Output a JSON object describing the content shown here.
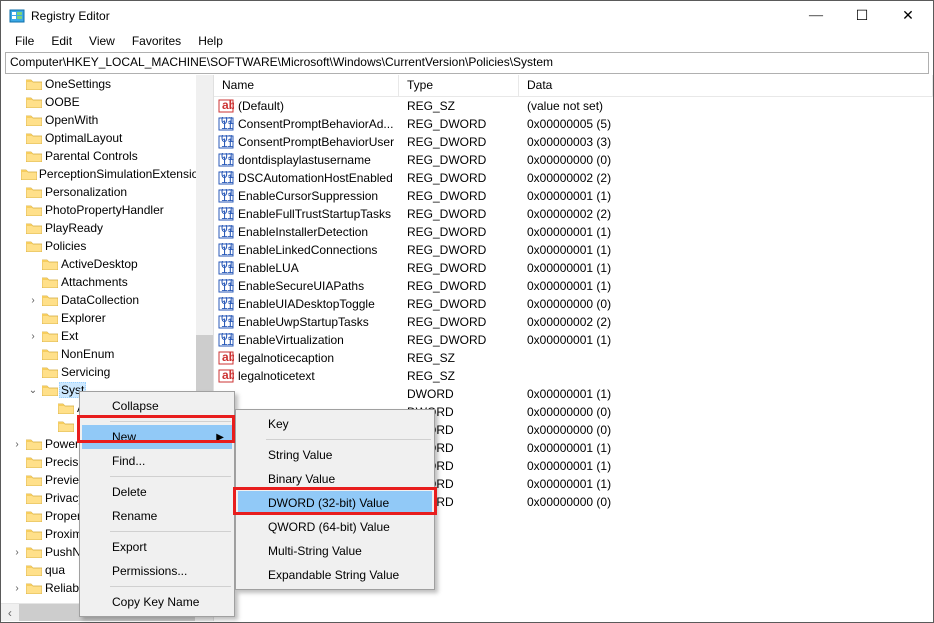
{
  "window": {
    "title": "Registry Editor"
  },
  "menu": {
    "file": "File",
    "edit": "Edit",
    "view": "View",
    "favorites": "Favorites",
    "help": "Help"
  },
  "address": {
    "path": "Computer\\HKEY_LOCAL_MACHINE\\SOFTWARE\\Microsoft\\Windows\\CurrentVersion\\Policies\\System"
  },
  "tree": {
    "items": [
      {
        "label": "OneSettings",
        "indent": 0,
        "expander": ""
      },
      {
        "label": "OOBE",
        "indent": 0,
        "expander": ""
      },
      {
        "label": "OpenWith",
        "indent": 0,
        "expander": ""
      },
      {
        "label": "OptimalLayout",
        "indent": 0,
        "expander": ""
      },
      {
        "label": "Parental Controls",
        "indent": 0,
        "expander": ""
      },
      {
        "label": "PerceptionSimulationExtensions",
        "indent": 0,
        "expander": ""
      },
      {
        "label": "Personalization",
        "indent": 0,
        "expander": ""
      },
      {
        "label": "PhotoPropertyHandler",
        "indent": 0,
        "expander": ""
      },
      {
        "label": "PlayReady",
        "indent": 0,
        "expander": ""
      },
      {
        "label": "Policies",
        "indent": 0,
        "expander": ""
      },
      {
        "label": "ActiveDesktop",
        "indent": 1,
        "expander": ""
      },
      {
        "label": "Attachments",
        "indent": 1,
        "expander": ""
      },
      {
        "label": "DataCollection",
        "indent": 1,
        "expander": ">"
      },
      {
        "label": "Explorer",
        "indent": 1,
        "expander": ""
      },
      {
        "label": "Ext",
        "indent": 1,
        "expander": ">"
      },
      {
        "label": "NonEnum",
        "indent": 1,
        "expander": ""
      },
      {
        "label": "Servicing",
        "indent": 1,
        "expander": ""
      },
      {
        "label": "Syst",
        "indent": 1,
        "expander": "v",
        "selected": true
      },
      {
        "label": "A",
        "indent": 2,
        "expander": ""
      },
      {
        "label": "U",
        "indent": 2,
        "expander": ""
      },
      {
        "label": "PowerE",
        "indent": 0,
        "expander": ">"
      },
      {
        "label": "Precisio",
        "indent": 0,
        "expander": ""
      },
      {
        "label": "Preview",
        "indent": 0,
        "expander": ""
      },
      {
        "label": "Privacy",
        "indent": 0,
        "expander": ""
      },
      {
        "label": "Proper",
        "indent": 0,
        "expander": ""
      },
      {
        "label": "Proxim",
        "indent": 0,
        "expander": ""
      },
      {
        "label": "PushN",
        "indent": 0,
        "expander": ">"
      },
      {
        "label": "qua",
        "indent": 0,
        "expander": ""
      },
      {
        "label": "Reliability",
        "indent": 0,
        "expander": ">"
      }
    ]
  },
  "list": {
    "columns": {
      "name": "Name",
      "type": "Type",
      "data": "Data"
    },
    "rows": [
      {
        "icon": "sz",
        "name": "(Default)",
        "type": "REG_SZ",
        "data": "(value not set)"
      },
      {
        "icon": "dw",
        "name": "ConsentPromptBehaviorAd...",
        "type": "REG_DWORD",
        "data": "0x00000005 (5)"
      },
      {
        "icon": "dw",
        "name": "ConsentPromptBehaviorUser",
        "type": "REG_DWORD",
        "data": "0x00000003 (3)"
      },
      {
        "icon": "dw",
        "name": "dontdisplaylastusername",
        "type": "REG_DWORD",
        "data": "0x00000000 (0)"
      },
      {
        "icon": "dw",
        "name": "DSCAutomationHostEnabled",
        "type": "REG_DWORD",
        "data": "0x00000002 (2)"
      },
      {
        "icon": "dw",
        "name": "EnableCursorSuppression",
        "type": "REG_DWORD",
        "data": "0x00000001 (1)"
      },
      {
        "icon": "dw",
        "name": "EnableFullTrustStartupTasks",
        "type": "REG_DWORD",
        "data": "0x00000002 (2)"
      },
      {
        "icon": "dw",
        "name": "EnableInstallerDetection",
        "type": "REG_DWORD",
        "data": "0x00000001 (1)"
      },
      {
        "icon": "dw",
        "name": "EnableLinkedConnections",
        "type": "REG_DWORD",
        "data": "0x00000001 (1)"
      },
      {
        "icon": "dw",
        "name": "EnableLUA",
        "type": "REG_DWORD",
        "data": "0x00000001 (1)"
      },
      {
        "icon": "dw",
        "name": "EnableSecureUIAPaths",
        "type": "REG_DWORD",
        "data": "0x00000001 (1)"
      },
      {
        "icon": "dw",
        "name": "EnableUIADesktopToggle",
        "type": "REG_DWORD",
        "data": "0x00000000 (0)"
      },
      {
        "icon": "dw",
        "name": "EnableUwpStartupTasks",
        "type": "REG_DWORD",
        "data": "0x00000002 (2)"
      },
      {
        "icon": "dw",
        "name": "EnableVirtualization",
        "type": "REG_DWORD",
        "data": "0x00000001 (1)"
      },
      {
        "icon": "sz",
        "name": "legalnoticecaption",
        "type": "REG_SZ",
        "data": ""
      },
      {
        "icon": "sz",
        "name": "legalnoticetext",
        "type": "REG_SZ",
        "data": ""
      },
      {
        "icon": "",
        "name": "",
        "type": "DWORD",
        "data": "0x00000001 (1)"
      },
      {
        "icon": "",
        "name": "",
        "type": "DWORD",
        "data": "0x00000000 (0)"
      },
      {
        "icon": "",
        "name": "",
        "type": "DWORD",
        "data": "0x00000000 (0)"
      },
      {
        "icon": "",
        "name": "",
        "type": "DWORD",
        "data": "0x00000001 (1)"
      },
      {
        "icon": "",
        "name": "",
        "type": "DWORD",
        "data": "0x00000001 (1)"
      },
      {
        "icon": "",
        "name": "",
        "type": "DWORD",
        "data": "0x00000001 (1)"
      },
      {
        "icon": "",
        "name": "",
        "type": "DWORD",
        "data": "0x00000000 (0)"
      }
    ]
  },
  "context_menu_1": {
    "collapse": "Collapse",
    "new": "New",
    "find": "Find...",
    "delete": "Delete",
    "rename": "Rename",
    "export": "Export",
    "permissions": "Permissions...",
    "copy_key_name": "Copy Key Name"
  },
  "context_menu_2": {
    "key": "Key",
    "string_value": "String Value",
    "binary_value": "Binary Value",
    "dword_32": "DWORD (32-bit) Value",
    "qword_64": "QWORD (64-bit) Value",
    "multi_string": "Multi-String Value",
    "expandable_string": "Expandable String Value"
  }
}
